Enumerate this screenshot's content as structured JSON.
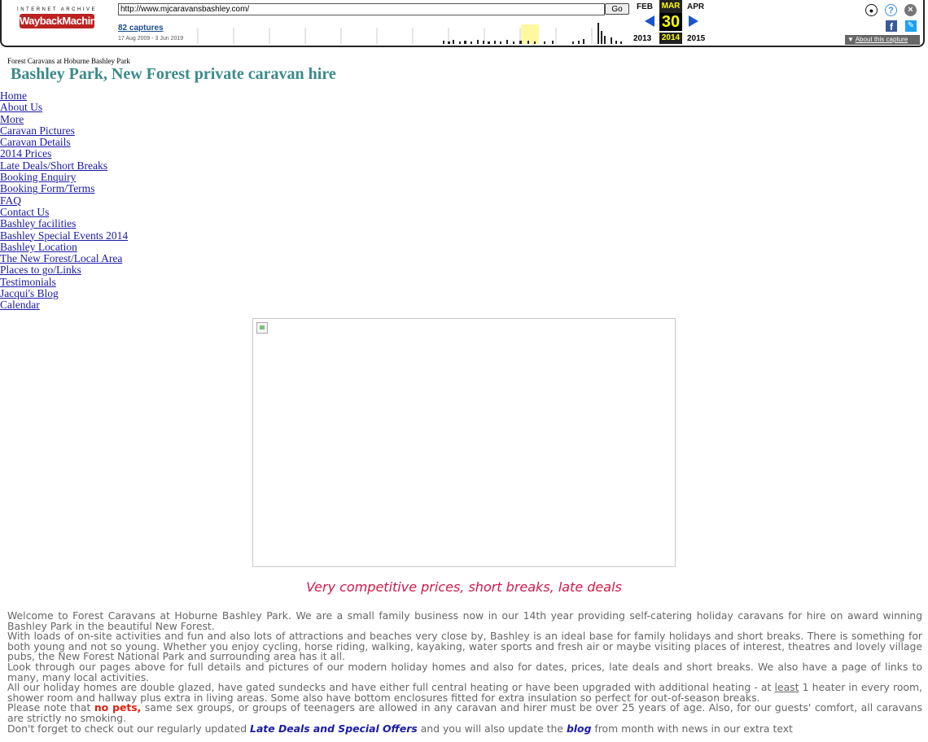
{
  "toolbar": {
    "brand_top": "INTERNET ARCHIVE",
    "brand_logo": "WaybackMachine",
    "url": "http://www.mjcaravansbashley.com/",
    "go_label": "Go",
    "captures": "82 captures",
    "range": "17 Aug 2009 - 3 Jun 2019",
    "prev_month": "FEB",
    "current_month": "MAR",
    "next_month": "APR",
    "day": "30",
    "prev_year": "2013",
    "current_year": "2014",
    "next_year": "2015",
    "about_label": "About this capture",
    "icons": [
      "user-icon",
      "help-icon",
      "close-icon",
      "facebook-icon",
      "twitter-icon"
    ]
  },
  "site": {
    "small_title": "Forest Caravans at Hoburne Bashley Park",
    "title": "Bashley Park, New Forest private caravan hire"
  },
  "nav": [
    "Home",
    "About Us",
    "More",
    "Caravan Pictures",
    "Caravan Details",
    "2014 Prices",
    "Late Deals/Short Breaks",
    "Booking Enquiry",
    "Booking Form/Terms",
    "FAQ",
    "Contact Us",
    "Bashley facilities",
    "Bashley Special Events 2014",
    "Bashley Location",
    "The New Forest/Local Area",
    "Places to go/Links",
    "Testimonials",
    "Jacqui's Blog",
    "Calendar"
  ],
  "tagline": "Very competitive prices, short breaks, late deals",
  "content": {
    "p1": "Welcome to Forest Caravans at Hoburne Bashley Park.  We are a small family business now in our 14th year providing self-catering holiday caravans for hire on award winning Bashley Park in the beautiful New Forest.",
    "p2": "With loads of on-site activities and fun and also lots of attractions and beaches very close by, Bashley is an ideal base for family holidays and short breaks.   There is something for both young and not so young.  Whether you enjoy cycling, horse riding, walking, kayaking, water sports and fresh air or maybe visiting places of interest, theatres and lovely village pubs, the New Forest National Park and surrounding area has it all.",
    "p3": "Look through our pages above for full details and pictures of our modern holiday homes and also for dates, prices, late deals and short breaks.  We also have a page of links to many, many local activities.",
    "p4_a": "All our holiday homes are double glazed, have gated sundecks and have either full central heating or have been upgraded with additional heating - at ",
    "p4_u": "least",
    "p4_b": " 1 heater in every room, shower room and hallway plus extra in living areas.  Some also have bottom enclosures fitted for extra insulation so perfect for out-of-season breaks.",
    "p5_a": "Please note that ",
    "p5_red": "no pets,",
    "p5_b": " same sex groups, or groups of teenagers are allowed in any caravan and hirer must be over 25 years of age.  Also, for our guests' comfort, all caravans are strictly no smoking.",
    "p6_a": "Don't forget to check out our regularly updated ",
    "p6_link": "Late Deals and Special Offers",
    "p6_b": " and you will also update the ",
    "p6_link2": "blog",
    "p6_c": " from month with news in our extra text"
  }
}
